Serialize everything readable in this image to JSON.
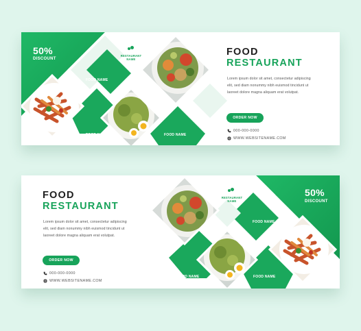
{
  "banner_top": {
    "discount_percent": "50%",
    "discount_label": "DISCOUNT",
    "brand_line1": "RESTAURANT",
    "brand_line2": "NAME",
    "food_names": [
      "FOOD NAME",
      "FOOD NAME",
      "FOOD NAME"
    ],
    "title_line1": "FOOD",
    "title_line2": "RESTAURANT",
    "body_lines": [
      "Lorem ipsum dolor sit amet, consectetur adipiscing",
      "elit, sed diam nonummy nibh euismod tincidunt ut",
      "laoreet dolore magna aliquam erat volutpat."
    ],
    "button_label": "ORDER NOW",
    "phone": "000-000-0000",
    "website": "WWW.WEBSITENAME.COM"
  },
  "banner_bottom": {
    "discount_percent": "50%",
    "discount_label": "DISCOUNT",
    "brand_line1": "RESTAURANT",
    "brand_line2": "NAME",
    "food_names": [
      "FOOD NAME",
      "FOOD NAME",
      "FOOD NAME"
    ],
    "title_line1": "FOOD",
    "title_line2": "RESTAURANT",
    "body_lines": [
      "Lorem ipsum dolor sit amet, consectetur adipiscing",
      "elit, sed diam nonummy nibh euismod tincidunt ut",
      "laoreet dolore magna aliquam erat volutpat."
    ],
    "button_label": "ORDER NOW",
    "phone": "000-000-0000",
    "website": "WWW.WEBSITENAME.COM"
  },
  "colors": {
    "background": "#dff5ec",
    "accent_green": "#17a35a",
    "light_green": "#2fbe74",
    "dark_text": "#1e1e1e"
  },
  "icons": [
    "phone-icon",
    "globe-icon",
    "restaurant-logo-icon"
  ]
}
